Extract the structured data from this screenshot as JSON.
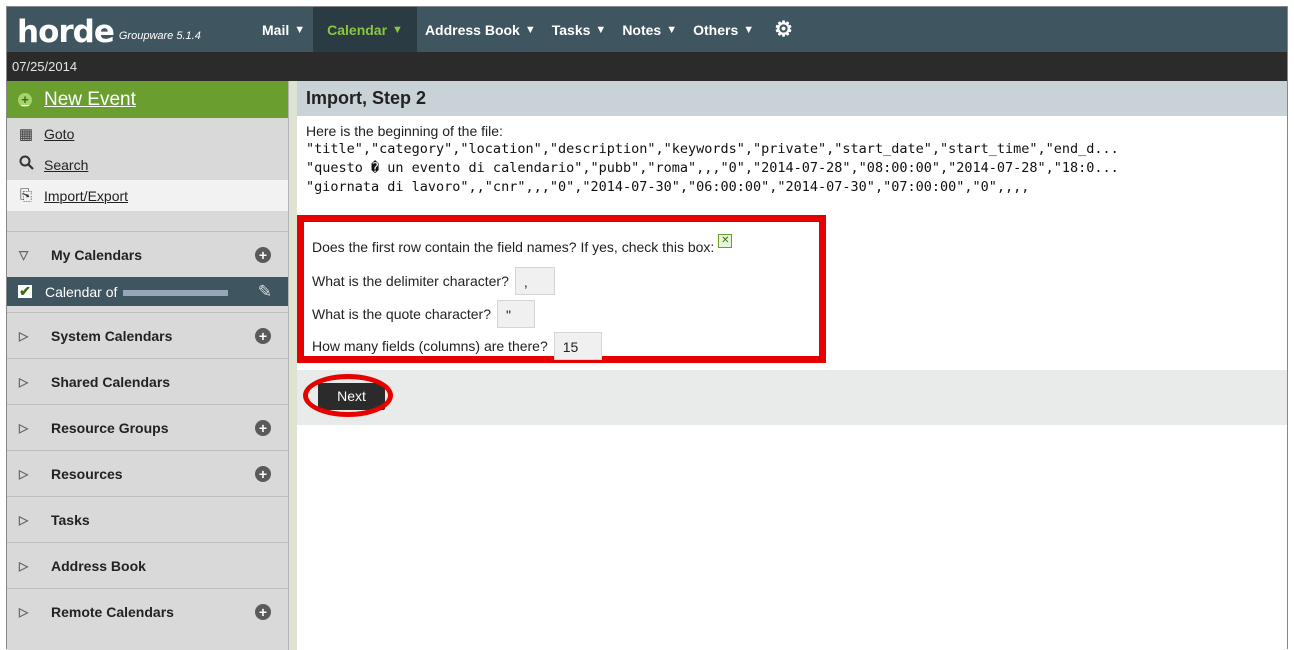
{
  "app": {
    "logo_word": "horde",
    "logo_sub": "Groupware 5.1.4",
    "date": "07/25/2014"
  },
  "menu": {
    "items": [
      {
        "label": "Mail"
      },
      {
        "label": "Calendar"
      },
      {
        "label": "Address Book"
      },
      {
        "label": "Tasks"
      },
      {
        "label": "Notes"
      },
      {
        "label": "Others"
      }
    ],
    "active": "Calendar",
    "settings_icon": "gear-icon"
  },
  "sidebar": {
    "new_event": "New Event",
    "links": [
      {
        "label": "Goto",
        "icon": "goto-icon"
      },
      {
        "label": "Search",
        "icon": "search-icon"
      },
      {
        "label": "Import/Export",
        "icon": "import-export-icon"
      }
    ],
    "my_calendars": "My Calendars",
    "calendar_item": "Calendar of",
    "sections": [
      {
        "label": "System Calendars",
        "add": true
      },
      {
        "label": "Shared Calendars",
        "add": false
      },
      {
        "label": "Resource Groups",
        "add": true
      },
      {
        "label": "Resources",
        "add": true
      },
      {
        "label": "Tasks",
        "add": false
      },
      {
        "label": "Address Book",
        "add": false
      },
      {
        "label": "Remote Calendars",
        "add": true
      }
    ]
  },
  "main": {
    "title": "Import, Step 2",
    "intro": "Here is the beginning of the file:",
    "file_lines": [
      "\"title\",\"category\",\"location\",\"description\",\"keywords\",\"private\",\"start_date\",\"start_time\",\"end_d...",
      "\"questo � un evento di calendario\",\"pubb\",\"roma\",,,\"0\",\"2014-07-28\",\"08:00:00\",\"2014-07-28\",\"18:0...",
      "\"giornata di lavoro\",,\"cnr\",,,\"0\",\"2014-07-30\",\"06:00:00\",\"2014-07-30\",\"07:00:00\",\"0\",,,,"
    ],
    "form": {
      "header_question": "Does the first row contain the field names? If yes, check this box:",
      "header_checked": true,
      "delimiter_label": "What is the delimiter character?",
      "delimiter_value": ",",
      "quote_label": "What is the quote character?",
      "quote_value": "\"",
      "fields_label": "How many fields (columns) are there?",
      "fields_value": "15"
    },
    "next_label": "Next"
  },
  "colors": {
    "topbar": "#3f5560",
    "active_menu_text": "#8cc63f",
    "new_event_bg": "#6a9e2f",
    "highlight": "#e60000"
  }
}
